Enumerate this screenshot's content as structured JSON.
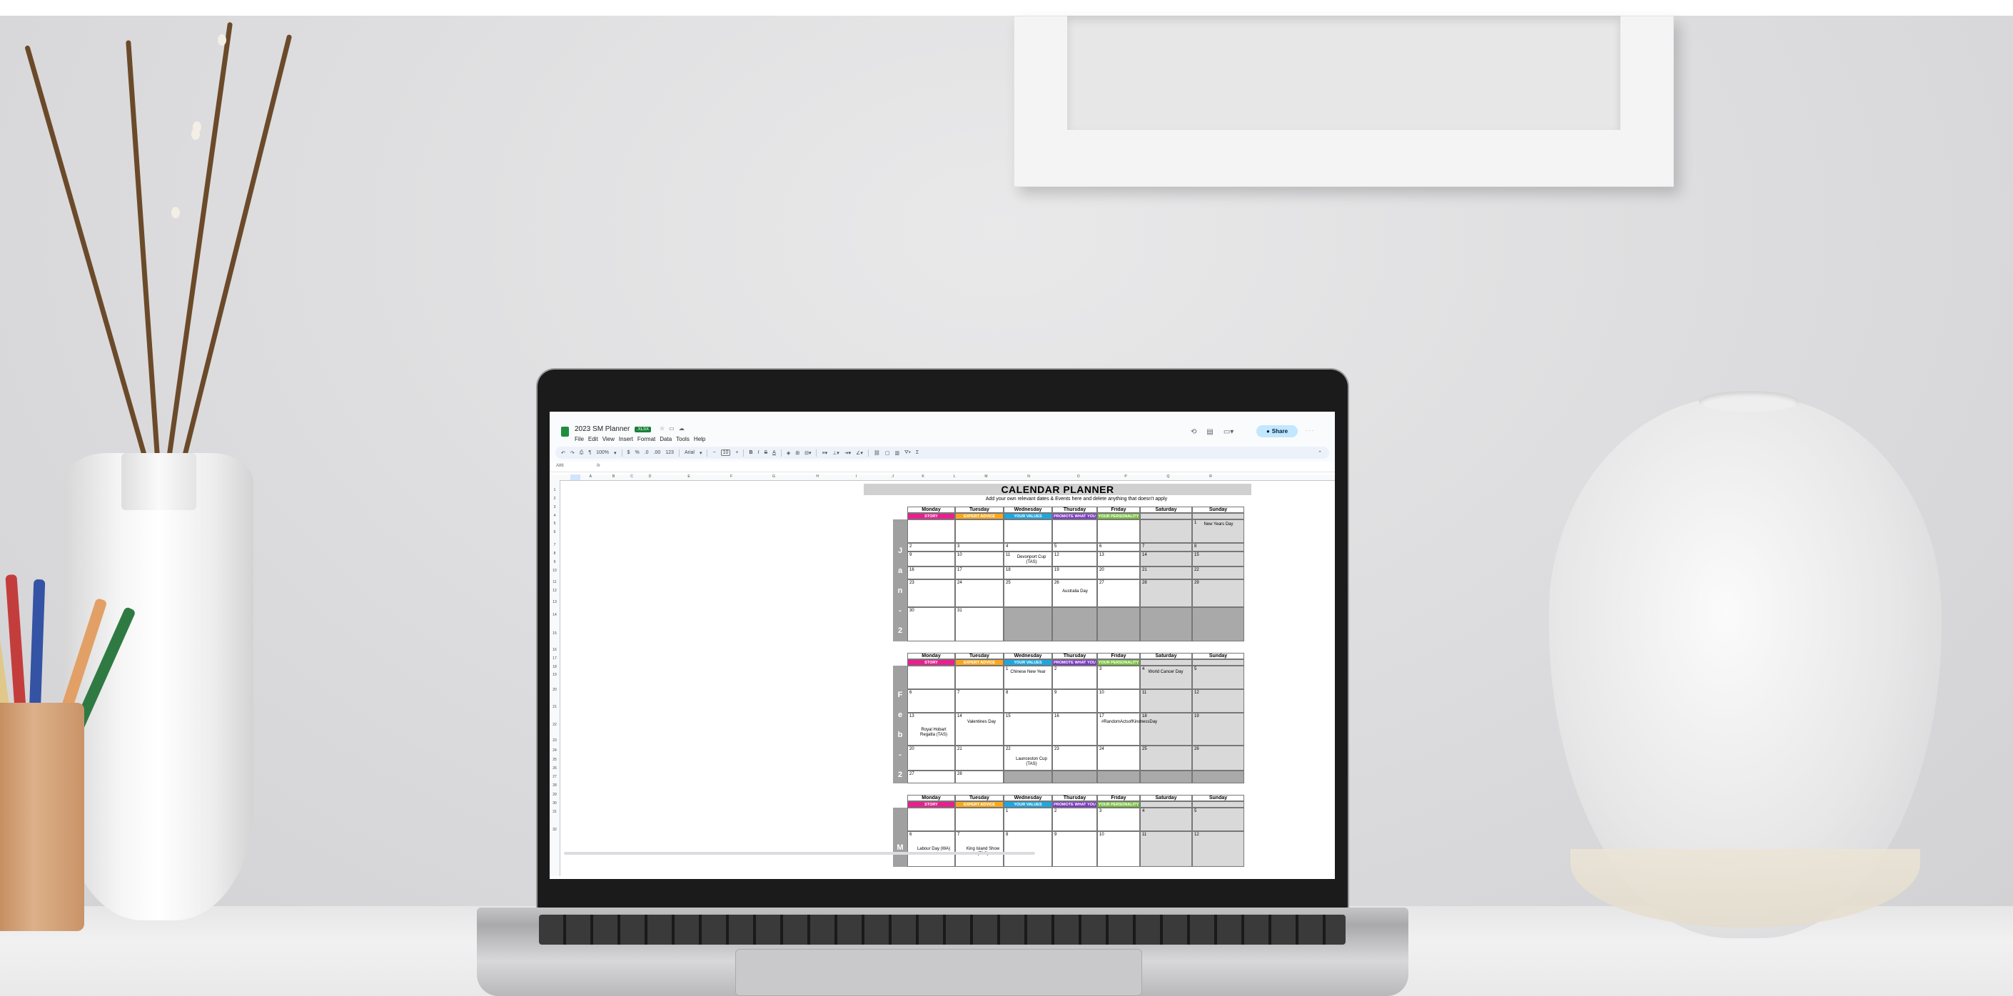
{
  "app": {
    "doc_title": "2023 SM Planner",
    "file_badge": ".XLSX",
    "menu": [
      "File",
      "Edit",
      "View",
      "Insert",
      "Format",
      "Data",
      "Tools",
      "Help"
    ],
    "share_label": "Share"
  },
  "toolbar": {
    "zoom": "100%",
    "currency": "$",
    "percent": "%",
    "decimals_less": ".0",
    "decimals_more": ".00",
    "number_format": "123",
    "font": "Arial",
    "font_size": "10",
    "bold": "B",
    "italic": "I",
    "strike": "S",
    "text_color": "A"
  },
  "formula_bar": {
    "name_box": "A86",
    "fx": "fx"
  },
  "columns": [
    "A",
    "B",
    "C",
    "D",
    "E",
    "F",
    "G",
    "H",
    "I",
    "J",
    "K",
    "L",
    "M",
    "N",
    "O",
    "P",
    "Q",
    "R"
  ],
  "rows": [
    "1",
    "2",
    "3",
    "4",
    "5",
    "6",
    "7",
    "8",
    "9",
    "10",
    "11",
    "12",
    "13",
    "14",
    "15",
    "16",
    "17",
    "18",
    "19",
    "20",
    "21",
    "22",
    "23",
    "24",
    "25",
    "26",
    "27",
    "28",
    "29",
    "30",
    "31",
    "32"
  ],
  "planner": {
    "title": "CALENDAR PLANNER",
    "subtitle": "Add your own relevant dates & Events here and delete anything that doesn't apply",
    "days": [
      "Monday",
      "Tuesday",
      "Wednesday",
      "Thursday",
      "Friday",
      "Saturday",
      "Sunday"
    ],
    "tags": [
      {
        "label": "STORY",
        "color": "#e8208e"
      },
      {
        "label": "EXPERT ADVICE",
        "color": "#f6a821"
      },
      {
        "label": "YOUR VALUES",
        "color": "#1fa6df"
      },
      {
        "label": "PROMOTE WHAT YOU OFFER",
        "color": "#7b39c1"
      },
      {
        "label": "YOUR PERSONALITY",
        "color": "#7ac143"
      }
    ],
    "months": {
      "jan": "J a n - 2 3",
      "feb": "F e b - 2 3",
      "mar": "M"
    },
    "jan": {
      "w1": [
        "",
        "",
        "",
        "",
        "",
        "",
        "1"
      ],
      "w2": [
        "2",
        "3",
        "4",
        "5",
        "6",
        "7",
        "8"
      ],
      "w3": [
        "9",
        "10",
        "11",
        "12",
        "13",
        "14",
        "15"
      ],
      "w4": [
        "16",
        "17",
        "18",
        "19",
        "20",
        "21",
        "22"
      ],
      "w5": [
        "23",
        "24",
        "25",
        "26",
        "27",
        "28",
        "29"
      ],
      "w6": [
        "30",
        "31"
      ],
      "events": {
        "new_years": "New Years Day",
        "devonport": "Devonport Cup (TAS)",
        "australia": "Australia Day"
      }
    },
    "feb": {
      "w1": [
        "",
        "",
        "1",
        "2",
        "3",
        "4",
        "5"
      ],
      "w2": [
        "6",
        "7",
        "8",
        "9",
        "10",
        "11",
        "12"
      ],
      "w3": [
        "13",
        "14",
        "15",
        "16",
        "17",
        "18",
        "19"
      ],
      "w4": [
        "20",
        "21",
        "22",
        "23",
        "24",
        "25",
        "26"
      ],
      "w5": [
        "27",
        "28"
      ],
      "events": {
        "cny": "Chinese New Year",
        "cancer": "World Cancer Day",
        "regatta": "Royal Hobart Regatta (TAS)",
        "valentine": "Valentines Day",
        "kindness": "#RandomActsofKindnessDay",
        "launceston": "Launceston Cup (TAS)"
      }
    },
    "mar": {
      "w1": [
        "",
        "",
        "1",
        "2",
        "3",
        "4",
        "5"
      ],
      "w2": [
        "6",
        "7",
        "8",
        "9",
        "10",
        "11",
        "12"
      ],
      "events": {
        "labour": "Labour Day (WA)",
        "king_island": "King Island Show (TAS)"
      }
    }
  }
}
